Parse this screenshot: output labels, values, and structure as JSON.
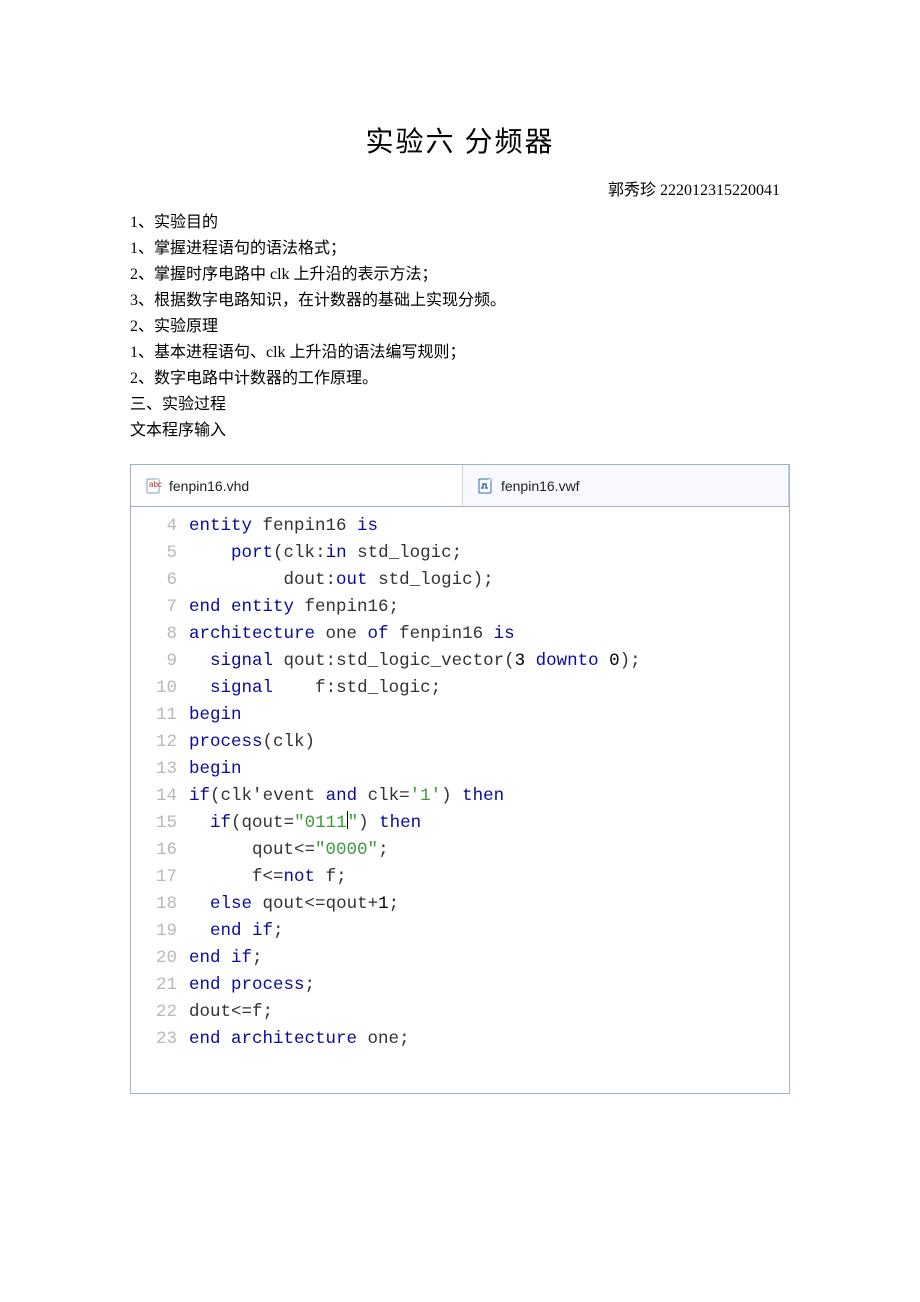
{
  "doc": {
    "title": "实验六   分频器",
    "author": "郭秀珍  222012315220041",
    "lines": [
      "1、实验目的",
      "1、掌握进程语句的语法格式；",
      "2、掌握时序电路中 clk 上升沿的表示方法；",
      "3、根据数字电路知识，在计数器的基础上实现分频。",
      "2、实验原理",
      "1、基本进程语句、clk 上升沿的语法编写规则；",
      "2、数字电路中计数器的工作原理。",
      "三、实验过程",
      "文本程序输入"
    ]
  },
  "editor": {
    "tabs": {
      "vhd": "fenpin16.vhd",
      "vwf": "fenpin16.vwf"
    },
    "code": [
      {
        "n": 4,
        "tokens": [
          [
            "kw",
            "entity"
          ],
          [
            "",
            ""
          ],
          [
            "ident",
            " fenpin16 "
          ],
          [
            "kw",
            "is"
          ]
        ]
      },
      {
        "n": 5,
        "tokens": [
          [
            "",
            "    "
          ],
          [
            "kw",
            "port"
          ],
          [
            "punct",
            "("
          ],
          [
            "ident",
            "clk"
          ],
          [
            "punct",
            ":"
          ],
          [
            "kw",
            "in"
          ],
          [
            "ident",
            " std_logic"
          ],
          [
            "punct",
            ";"
          ]
        ]
      },
      {
        "n": 6,
        "tokens": [
          [
            "",
            "         "
          ],
          [
            "ident",
            "dout"
          ],
          [
            "punct",
            ":"
          ],
          [
            "kw",
            "out"
          ],
          [
            "ident",
            " std_logic"
          ],
          [
            "punct",
            ");"
          ]
        ]
      },
      {
        "n": 7,
        "tokens": [
          [
            "kw",
            "end"
          ],
          [
            "kw",
            " entity"
          ],
          [
            "ident",
            " fenpin16"
          ],
          [
            "punct",
            ";"
          ]
        ]
      },
      {
        "n": 8,
        "tokens": [
          [
            "kw",
            "architecture"
          ],
          [
            "ident",
            " one "
          ],
          [
            "kw",
            "of"
          ],
          [
            "ident",
            " fenpin16 "
          ],
          [
            "kw",
            "is"
          ]
        ]
      },
      {
        "n": 9,
        "tokens": [
          [
            "",
            "  "
          ],
          [
            "kw",
            "signal"
          ],
          [
            "ident",
            " qout"
          ],
          [
            "punct",
            ":"
          ],
          [
            "ident",
            "std_logic_vector"
          ],
          [
            "punct",
            "("
          ],
          [
            "num",
            "3"
          ],
          [
            "kw",
            " downto "
          ],
          [
            "num",
            "0"
          ],
          [
            "punct",
            ");"
          ]
        ]
      },
      {
        "n": 10,
        "tokens": [
          [
            "",
            "  "
          ],
          [
            "kw",
            "signal"
          ],
          [
            "",
            "    "
          ],
          [
            "ident",
            "f"
          ],
          [
            "punct",
            ":"
          ],
          [
            "ident",
            "std_logic"
          ],
          [
            "punct",
            ";"
          ]
        ]
      },
      {
        "n": 11,
        "tokens": [
          [
            "kw",
            "begin"
          ]
        ]
      },
      {
        "n": 12,
        "tokens": [
          [
            "kw",
            "process"
          ],
          [
            "punct",
            "("
          ],
          [
            "ident",
            "clk"
          ],
          [
            "punct",
            ")"
          ]
        ]
      },
      {
        "n": 13,
        "tokens": [
          [
            "kw",
            "begin"
          ]
        ]
      },
      {
        "n": 14,
        "tokens": [
          [
            "kw",
            "if"
          ],
          [
            "punct",
            "("
          ],
          [
            "ident",
            "clk"
          ],
          [
            "punct",
            "'"
          ],
          [
            "ident",
            "event "
          ],
          [
            "kw",
            "and"
          ],
          [
            "ident",
            " clk"
          ],
          [
            "punct",
            "="
          ],
          [
            "str",
            "'1'"
          ],
          [
            "punct",
            ") "
          ],
          [
            "kw",
            "then"
          ]
        ]
      },
      {
        "n": 15,
        "tokens": [
          [
            "",
            "  "
          ],
          [
            "kw",
            "if"
          ],
          [
            "punct",
            "("
          ],
          [
            "ident",
            "qout"
          ],
          [
            "punct",
            "="
          ],
          [
            "str",
            "\"0111"
          ],
          [
            "cursor",
            ""
          ],
          [
            "str",
            "\""
          ],
          [
            "punct",
            ") "
          ],
          [
            "kw",
            "then"
          ]
        ]
      },
      {
        "n": 16,
        "tokens": [
          [
            "",
            "      "
          ],
          [
            "ident",
            "qout"
          ],
          [
            "punct",
            "<="
          ],
          [
            "str",
            "\"0000\""
          ],
          [
            "punct",
            ";"
          ]
        ]
      },
      {
        "n": 17,
        "tokens": [
          [
            "",
            "      "
          ],
          [
            "ident",
            "f"
          ],
          [
            "punct",
            "<="
          ],
          [
            "kw",
            "not"
          ],
          [
            "ident",
            " f"
          ],
          [
            "punct",
            ";"
          ]
        ]
      },
      {
        "n": 18,
        "tokens": [
          [
            "",
            "  "
          ],
          [
            "kw",
            "else"
          ],
          [
            "ident",
            " qout"
          ],
          [
            "punct",
            "<="
          ],
          [
            "ident",
            "qout"
          ],
          [
            "punct",
            "+"
          ],
          [
            "num",
            "1"
          ],
          [
            "punct",
            ";"
          ]
        ]
      },
      {
        "n": 19,
        "tokens": [
          [
            "",
            "  "
          ],
          [
            "kw",
            "end"
          ],
          [
            "kw",
            " if"
          ],
          [
            "punct",
            ";"
          ]
        ]
      },
      {
        "n": 20,
        "tokens": [
          [
            "kw",
            "end"
          ],
          [
            "kw",
            " if"
          ],
          [
            "punct",
            ";"
          ]
        ]
      },
      {
        "n": 21,
        "tokens": [
          [
            "kw",
            "end"
          ],
          [
            "kw",
            " process"
          ],
          [
            "punct",
            ";"
          ]
        ]
      },
      {
        "n": 22,
        "tokens": [
          [
            "ident",
            "dout"
          ],
          [
            "punct",
            "<="
          ],
          [
            "ident",
            "f"
          ],
          [
            "punct",
            ";"
          ]
        ]
      },
      {
        "n": 23,
        "tokens": [
          [
            "kw",
            "end"
          ],
          [
            "kw",
            " architecture"
          ],
          [
            "ident",
            " one"
          ],
          [
            "punct",
            ";"
          ]
        ]
      }
    ]
  }
}
